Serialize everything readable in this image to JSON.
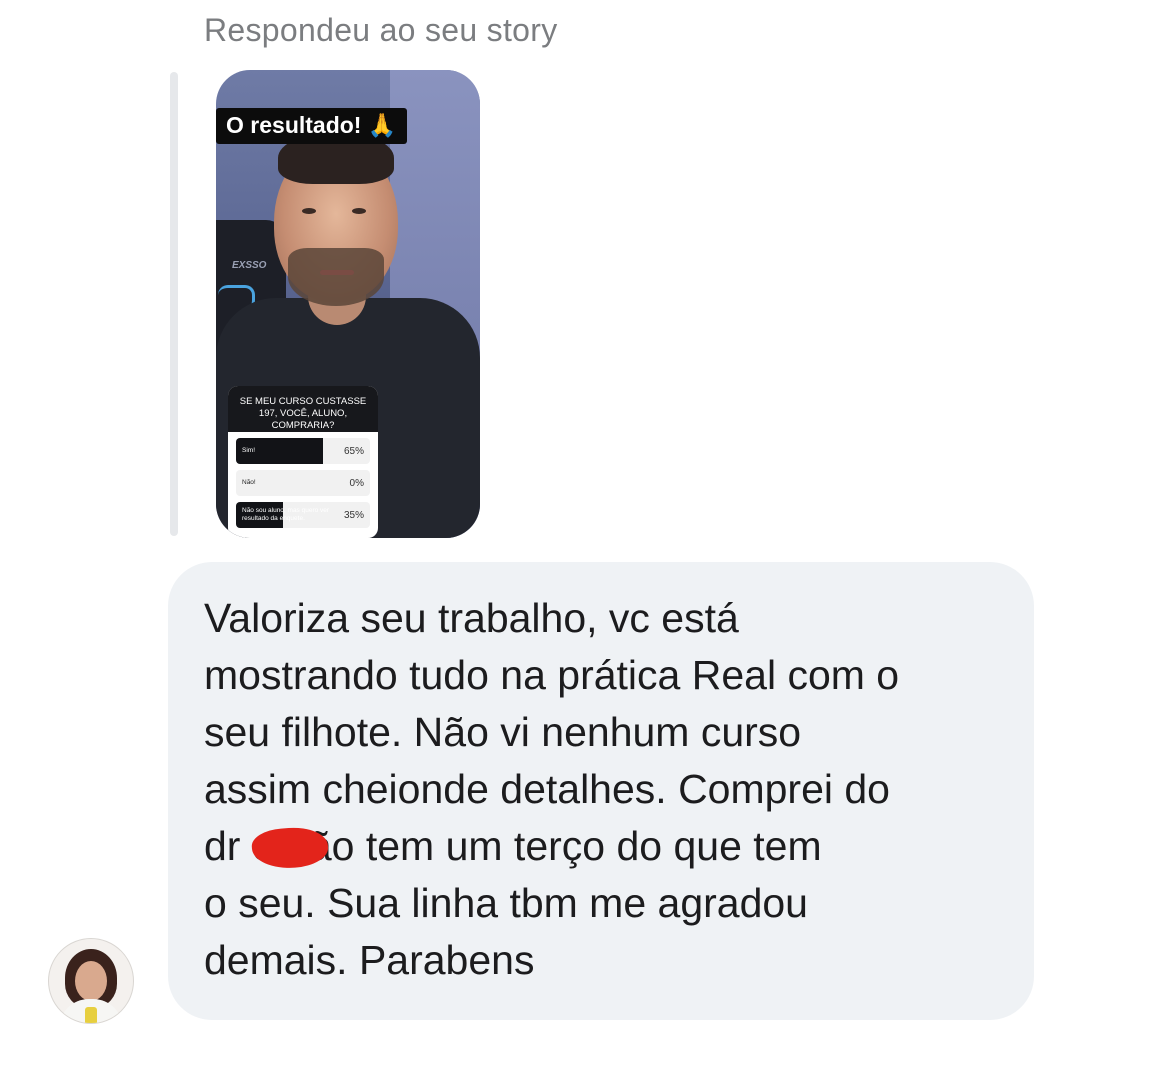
{
  "reply": {
    "caption": "Respondeu ao seu story"
  },
  "story": {
    "title": "O resultado! 🙏",
    "chair_brand": "EXSSO",
    "poll": {
      "question": "SE MEU CURSO CUSTASSE 197, VOCÊ, ALUNO, COMPRARIA?",
      "options": [
        {
          "label": "Sim!",
          "percent_text": "65%",
          "percent": 65
        },
        {
          "label": "Não!",
          "percent_text": "0%",
          "percent": 0
        },
        {
          "label": "Não sou aluno, mas quero ver resultado da enquete.",
          "percent_text": "35%",
          "percent": 35
        }
      ]
    }
  },
  "message": {
    "text": "Valoriza seu trabalho, vc está\nmostrando tudo na prática Real com o\nseu filhote. Não vi nenhum curso\nassim cheionde detalhes. Comprei do\ndr         e não tem um terço do que tem\no seu. Sua linha tbm me agradou\ndemais. Parabens"
  },
  "colors": {
    "bubble": "#eff2f5",
    "caption": "#7b7d80",
    "redaction": "#e3241b"
  }
}
